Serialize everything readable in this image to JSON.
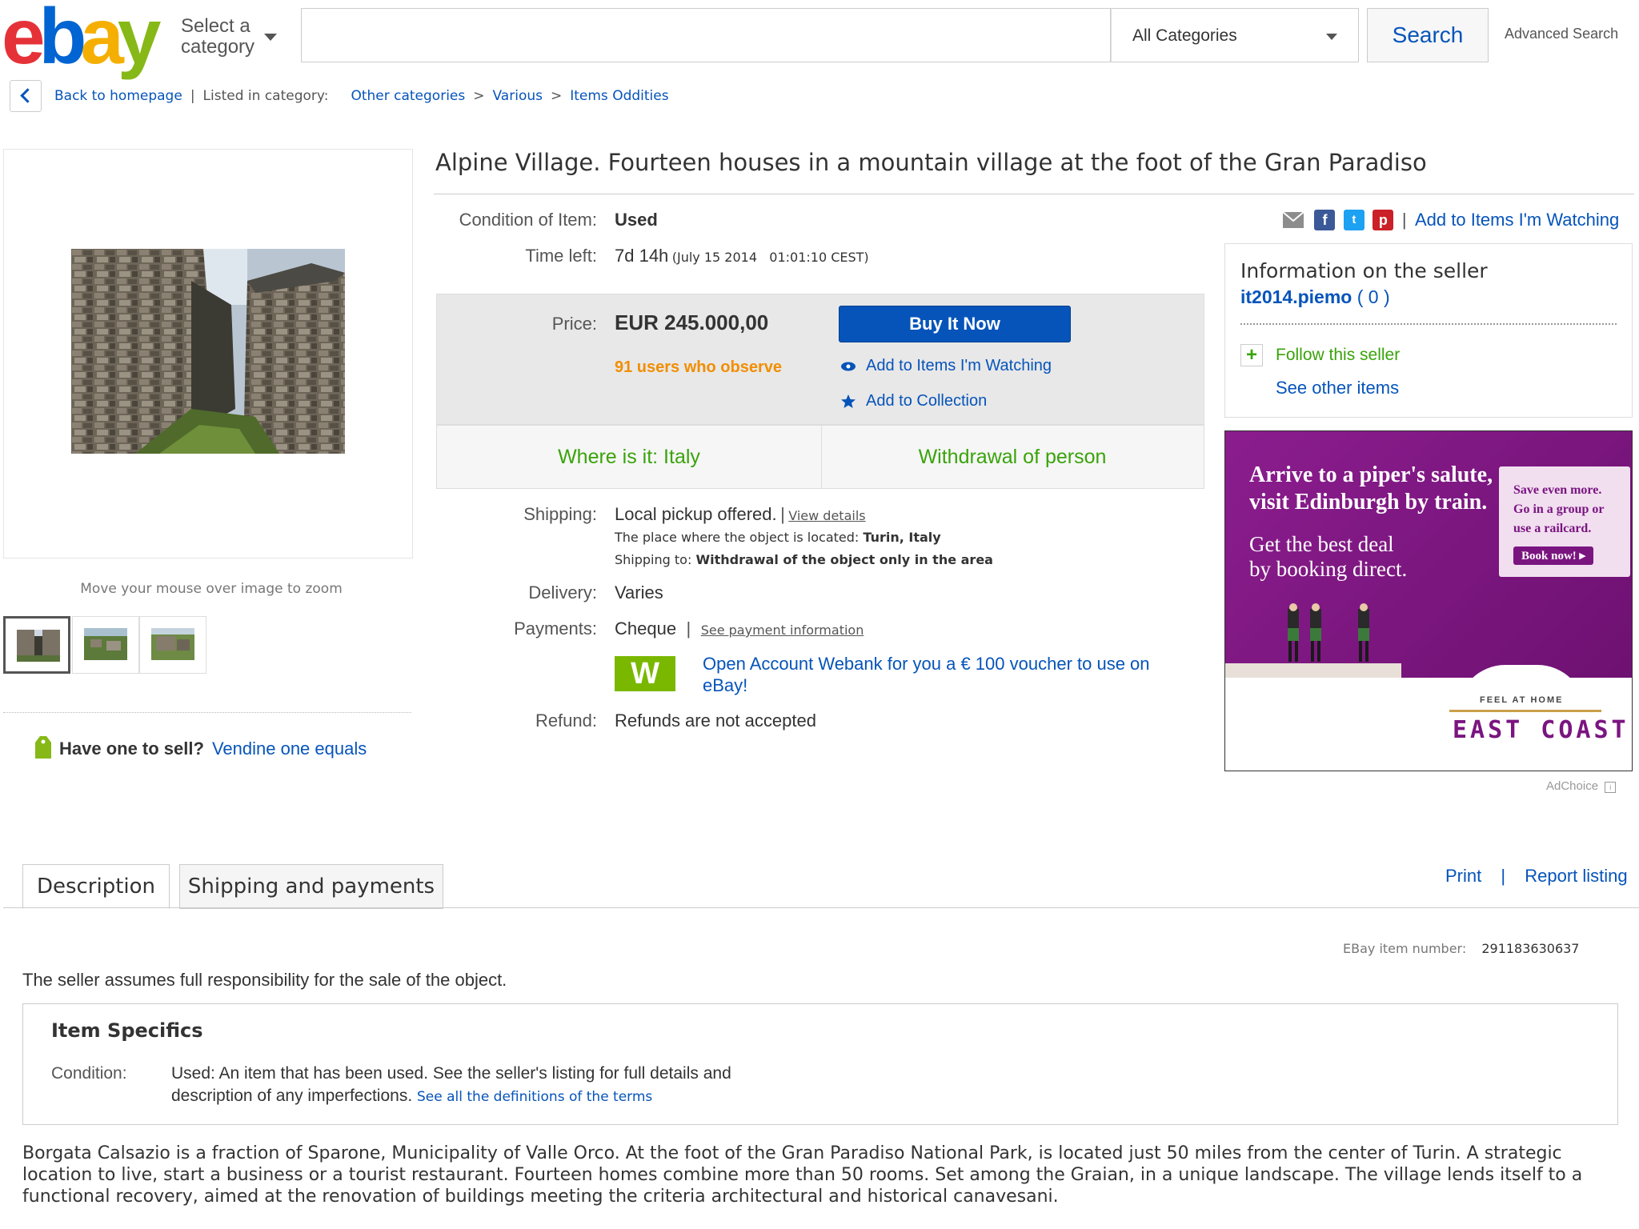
{
  "header": {
    "logo": {
      "e": "e",
      "b": "b",
      "a": "a",
      "y": "y"
    },
    "select_category_line1": "Select a",
    "select_category_line2": "category",
    "search_value": "",
    "category_dropdown": "All Categories",
    "search_button": "Search",
    "advanced_search": "Advanced Search"
  },
  "breadcrumb": {
    "back": "Back to homepage",
    "listed_in": "Listed in category:",
    "items": [
      "Other categories",
      "Various",
      "Items Oddities"
    ],
    "separator": ">",
    "divider": "|"
  },
  "gallery": {
    "zoom_hint": "Move your mouse over image to zoom",
    "thumbnail_count": 3
  },
  "sell": {
    "question": "Have one to sell?",
    "link": "Vendine one equals"
  },
  "item": {
    "title": "Alpine Village. Fourteen houses in a mountain village at the foot of the Gran Paradiso",
    "condition_label": "Condition of Item:",
    "condition": "Used",
    "time_left_label": "Time left:",
    "time_left": "7d 14h",
    "time_left_date": "(July 15 2014   01:01:10 CEST)",
    "add_watch_top": "Add to Items I'm Watching",
    "price_label": "Price:",
    "price": "EUR 245.000,00",
    "observers": "91 users who observe",
    "buy_now": "Buy It Now",
    "add_watch": "Add to Items I'm Watching",
    "add_collection": "Add to Collection",
    "location": "Where is it: Italy",
    "withdrawal": "Withdrawal of person",
    "shipping_label": "Shipping:",
    "shipping": "Local pickup offered.",
    "view_details": "View details",
    "place_label": "The place where the object is located:",
    "place": "Turin, Italy",
    "ship_to_label": "Shipping to:",
    "ship_to": "Withdrawal of the object only in the area",
    "delivery_label": "Delivery:",
    "delivery": "Varies",
    "payments_label": "Payments:",
    "payments": "Cheque",
    "payment_info": "See payment information",
    "webank_letter": "W",
    "webank_line1": "Open Account Webank for you a € 100 voucher to use on",
    "webank_line2": "eBay!",
    "refund_label": "Refund:",
    "refund": "Refunds are not accepted"
  },
  "seller": {
    "heading": "Information on the seller",
    "name": "it2014.piemo",
    "score": "( 0 )",
    "follow": "Follow this seller",
    "other_items": "See other items"
  },
  "ad": {
    "headline1": "Arrive to a piper's salute,",
    "headline2": "visit Edinburgh by train.",
    "sub1": "Get the best deal",
    "sub2": "by booking direct.",
    "side1": "Save even more.",
    "side2": "Go in a group or",
    "side3": "use a railcard.",
    "book": "Book now! ▸",
    "feel": "FEEL AT HOME",
    "brand": "EAST COAST",
    "adchoice": "AdChoice"
  },
  "tabs": {
    "description": "Description",
    "shipping": "Shipping and payments",
    "print": "Print",
    "report": "Report listing"
  },
  "description": {
    "item_number_label": "EBay item number:",
    "item_number": "291183630637",
    "responsibility": "The seller assumes full responsibility for the sale of the object.",
    "specifics_heading": "Item Specifics",
    "condition_label": "Condition:",
    "condition_line1": "Used: An item that has been used. See the seller's listing for full details and",
    "condition_line2": "description of any imperfections.",
    "definitions_link": "See all the definitions of the terms",
    "body": "Borgata Calsazio is a fraction of Sparone, Municipality of Valle Orco. At the foot of the Gran Paradiso National Park, is located just 50 miles from the center of Turin. A strategic location to live, start a business or a tourist restaurant. Fourteen homes combine more than 50 rooms. Set among the Graian, in a unique landscape. The village lends itself to a functional recovery, aimed at the renovation of buildings meeting the criteria architectural and historical canavesani."
  },
  "colors": {
    "brand_blue": "#0654ba",
    "price_orange": "#f18e00",
    "location_green": "#39a30a",
    "ad_purple": "#7a1580"
  }
}
